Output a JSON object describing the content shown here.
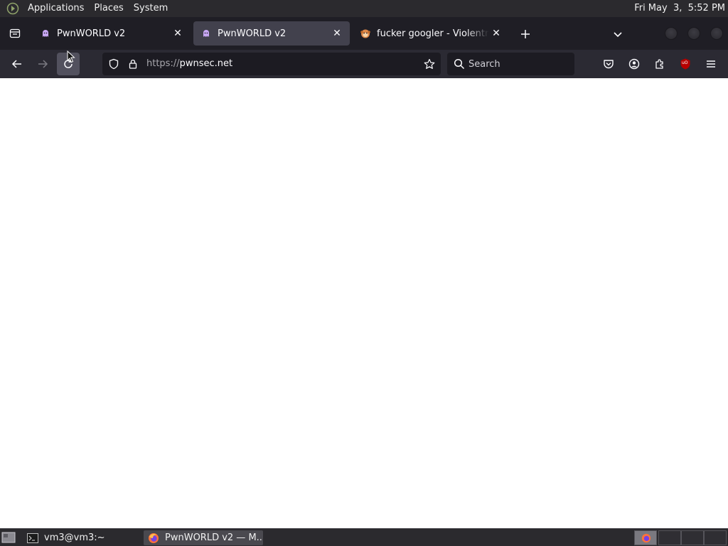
{
  "top_panel": {
    "menus": [
      "Applications",
      "Places",
      "System"
    ],
    "clock": "Fri May  3,  5:52 PM"
  },
  "tabs": [
    {
      "title": "PwnWORLD v2",
      "selected": false
    },
    {
      "title": "PwnWORLD v2",
      "selected": true
    },
    {
      "title": "fucker googler - Violentmonkey",
      "selected": false
    }
  ],
  "navbar": {
    "url_scheme": "https://",
    "url_host": "pwnsec.net",
    "search_placeholder": "Search",
    "ublock_badge": "uO"
  },
  "taskbar": {
    "items": [
      "vm3@vm3:~",
      "PwnWORLD v2 — M..."
    ]
  },
  "colors": {
    "panel_bg": "#2b2a2e",
    "tabstrip_bg": "#1f1e25",
    "selected_tab_bg": "#42414d",
    "toolbar_bg": "#2b2a33",
    "urlbar_bg": "#1c1b22",
    "ublock_red": "#b60000"
  }
}
